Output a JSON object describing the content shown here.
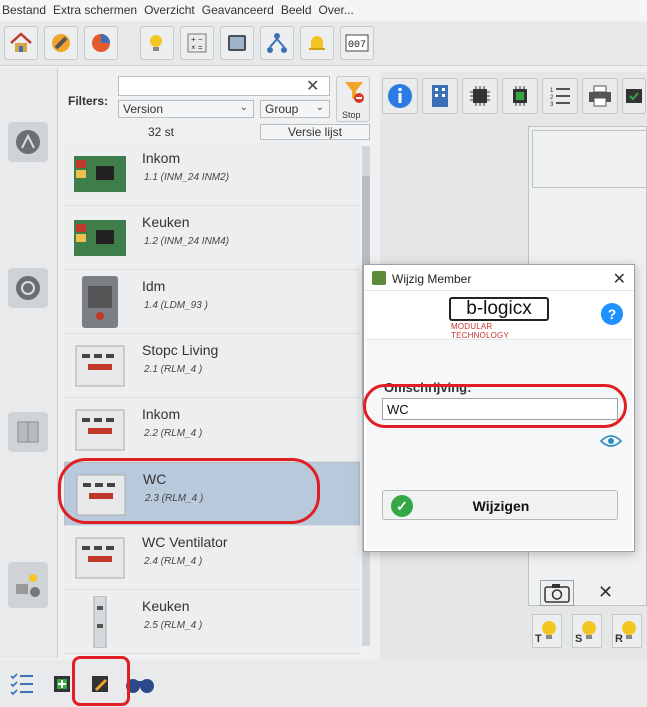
{
  "menu": [
    "Bestand",
    "Extra schermen",
    "Overzicht",
    "Geavanceerd",
    "Beeld",
    "Over..."
  ],
  "filters": {
    "label": "Filters:",
    "search_value": "",
    "version_select": "Version",
    "group_select": "Group",
    "stop_label": "Stop",
    "count": "32 st",
    "versie_lijst": "Versie lijst"
  },
  "members": [
    {
      "name": "Inkom",
      "code": "1.1 (INM_24 INM2)",
      "kind": "pcb"
    },
    {
      "name": "Keuken",
      "code": "1.2 (INM_24 INM4)",
      "kind": "pcb"
    },
    {
      "name": "Idm",
      "code": "1.4 (LDM_93 )",
      "kind": "box"
    },
    {
      "name": "Stopc Living",
      "code": "2.1 (RLM_4 )",
      "kind": "relay"
    },
    {
      "name": "Inkom",
      "code": "2.2 (RLM_4 )",
      "kind": "relay"
    },
    {
      "name": "WC",
      "code": "2.3 (RLM_4 )",
      "kind": "relay",
      "selected": true
    },
    {
      "name": "WC Ventilator",
      "code": "2.4 (RLM_4 )",
      "kind": "relay"
    },
    {
      "name": "Keuken",
      "code": "2.5 (RLM_4 )",
      "kind": "rail"
    }
  ],
  "dialog": {
    "title": "Wijzig Member",
    "logo_text": "b-logicx",
    "logo_tagline": "MODULAR TECHNOLOGY",
    "help": "?",
    "omschrijving_label": "Omschrijving:",
    "omschrijving_value": "WC",
    "submit_label": "Wijzigen",
    "close": "✕"
  },
  "right_panel_letters": [
    "T",
    "S",
    "R"
  ],
  "right_panel_close": "✕",
  "colors": {
    "accent_blue": "#1e90ff",
    "annotation_red": "#e01e24",
    "success_green": "#35a745"
  }
}
